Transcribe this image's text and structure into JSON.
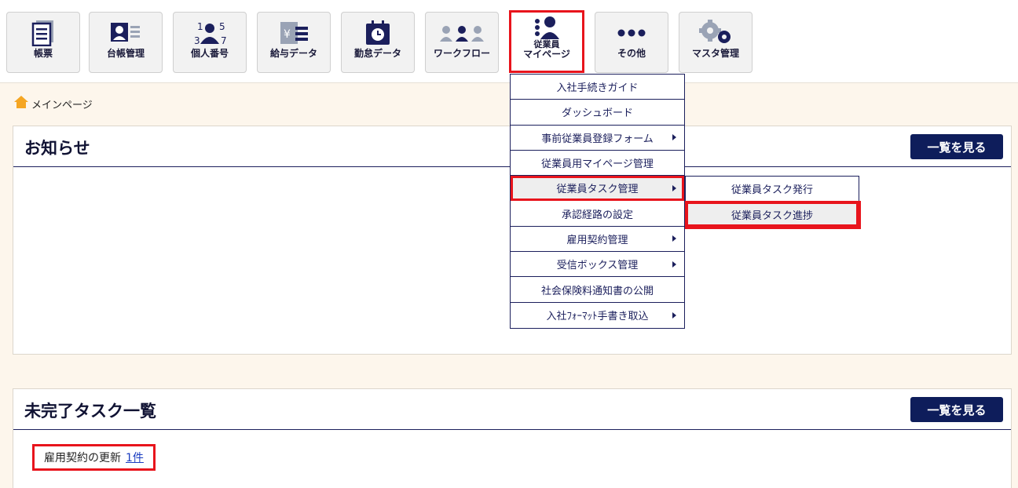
{
  "toolbar": {
    "items": [
      {
        "label": "帳票",
        "icon": "document-list-icon"
      },
      {
        "label": "台帳管理",
        "icon": "ledger-icon"
      },
      {
        "label": "個人番号",
        "icon": "personal-number-icon"
      },
      {
        "label": "給与データ",
        "icon": "salary-data-icon"
      },
      {
        "label": "勤怠データ",
        "icon": "attendance-clock-icon"
      },
      {
        "label": "ワークフロー",
        "icon": "workflow-people-icon"
      },
      {
        "label_line1": "従業員",
        "label_line2": "マイページ",
        "icon": "employee-mypage-icon"
      },
      {
        "label": "その他",
        "icon": "more-dots-icon"
      },
      {
        "label": "マスタ管理",
        "icon": "gears-icon"
      }
    ]
  },
  "breadcrumb": {
    "label": "メインページ",
    "icon": "home-icon"
  },
  "notices": {
    "title": "お知らせ",
    "list_button": "一覧を見る"
  },
  "tasks": {
    "title": "未完了タスク一覧",
    "list_button": "一覧を見る",
    "item_label": "雇用契約の更新",
    "item_count": "1件"
  },
  "dropdown": {
    "items": [
      {
        "label": "入社手続きガイド",
        "has_sub": false
      },
      {
        "label": "ダッシュボード",
        "has_sub": false
      },
      {
        "label": "事前従業員登録フォーム",
        "has_sub": true
      },
      {
        "label": "従業員用マイページ管理",
        "has_sub": false
      },
      {
        "label": "従業員タスク管理",
        "has_sub": true
      },
      {
        "label": "承認経路の設定",
        "has_sub": false
      },
      {
        "label": "雇用契約管理",
        "has_sub": true
      },
      {
        "label": "受信ボックス管理",
        "has_sub": true
      },
      {
        "label": "社会保険料通知書の公開",
        "has_sub": false
      },
      {
        "label": "入社ﾌｫｰﾏｯﾄ手書き取込",
        "has_sub": true
      }
    ],
    "submenu": [
      {
        "label": "従業員タスク発行"
      },
      {
        "label": "従業員タスク進捗"
      }
    ]
  },
  "colors": {
    "accent_red": "#e8141c",
    "navy": "#0e1d5b",
    "background": "#fdf6ec",
    "home_orange": "#f5a623"
  }
}
